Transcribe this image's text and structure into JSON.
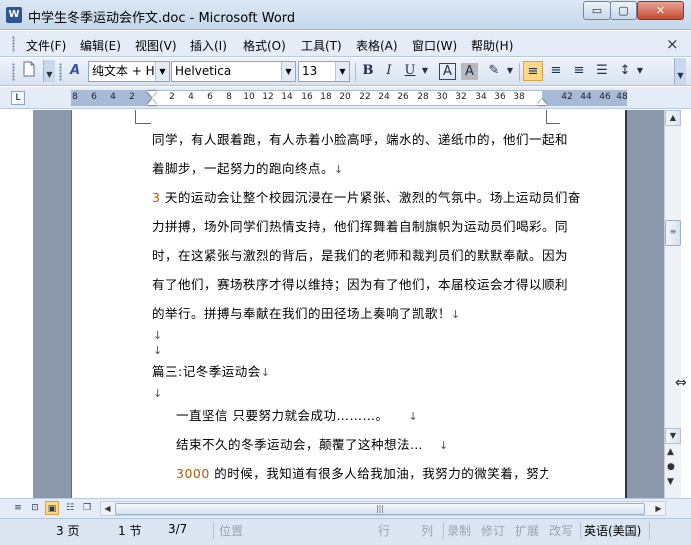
{
  "window": {
    "title": "中学生冬季运动会作文.doc - Microsoft Word",
    "app_icon": "W",
    "min": "▭",
    "max": "▢",
    "close": "✕"
  },
  "menu": [
    "文件(F)",
    "编辑(E)",
    "视图(V)",
    "插入(I)",
    "格式(O)",
    "工具(T)",
    "表格(A)",
    "窗口(W)",
    "帮助(H)"
  ],
  "menu_close": "×",
  "toolbar": {
    "style_value": "纯文本 + H",
    "font_value": "Helvetica",
    "size_value": "13",
    "bold": "B",
    "italic": "I",
    "underline": "U",
    "char_border": "A",
    "char_shading": "A",
    "highlight": "A"
  },
  "ruler": {
    "ticks": [
      "8",
      "6",
      "4",
      "2",
      "2",
      "4",
      "6",
      "8",
      "10",
      "12",
      "14",
      "16",
      "18",
      "20",
      "22",
      "24",
      "26",
      "28",
      "30",
      "32",
      "34",
      "36",
      "38",
      "42",
      "44",
      "46",
      "48"
    ]
  },
  "document": {
    "lines": [
      {
        "text": "同学，有人跟着跑，有人赤着小脸高呼，端水的、递纸巾的，他们一起和",
        "indent": false
      },
      {
        "text": "着脚步，一起努力的跑向终点。",
        "mark": "↓",
        "indent": false
      },
      {
        "num": "3",
        "text": " 天的运动会让整个校园沉浸在一片紧张、激烈的气氛中。场上运动员们奋",
        "indent": false
      },
      {
        "text": "力拼搏，场外同学们热情支持，他们挥舞着自制旗帜为运动员们喝彩。同",
        "indent": false
      },
      {
        "text": "时，在这紧张与激烈的背后，是我们的老师和裁判员们的默默奉献。因为",
        "indent": false
      },
      {
        "text": "有了他们，赛场秩序才得以维持；因为有了他们，本届校运会才得以顺利",
        "indent": false
      },
      {
        "text": "的举行。拼搏与奉献在我们的田径场上奏响了凯歌！",
        "mark": "↓",
        "indent": false
      }
    ],
    "empty_marks": [
      "↓",
      "↓"
    ],
    "heading": "篇三:记冬季运动会",
    "heading_mark": "↓",
    "after_heading_mark": "↓",
    "lines2": [
      {
        "text": "一直坚信  只要努力就会成功………。",
        "mark": "↓"
      },
      {
        "text": "结束不久的冬季运动会，颠覆了这种想法…",
        "mark": "↓"
      },
      {
        "num": "3000",
        "text": " 的时候，我知道有很多人给我加油，我努力的微笑着，努力使自"
      }
    ]
  },
  "status": {
    "page": "3 页",
    "section": "1 节",
    "page_of": "3/7",
    "position": "位置",
    "line": "行",
    "column": "列",
    "record": "录制",
    "revise": "修订",
    "extend": "扩展",
    "overwrite": "改写",
    "language": "英语(美国)"
  },
  "colors": {
    "accent": "#2b5797",
    "number_text": "#b35a00",
    "gray_area": "#8b97aa"
  }
}
